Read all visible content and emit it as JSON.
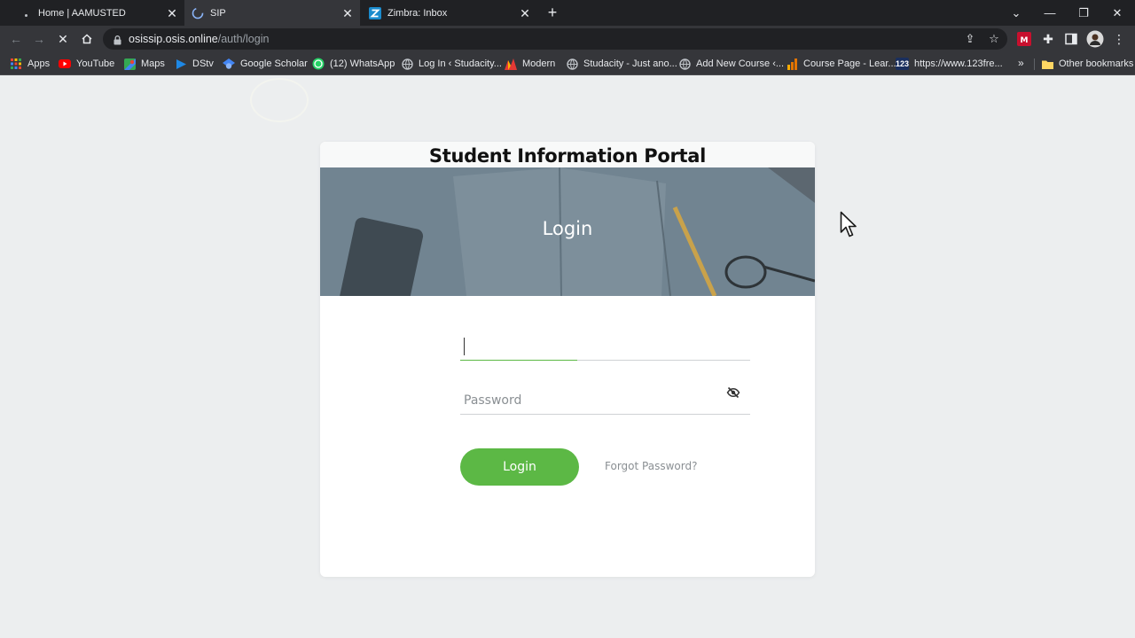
{
  "browser": {
    "tabs": [
      {
        "title": "Home | AAMUSTED",
        "icon": "dot-icon"
      },
      {
        "title": "SIP",
        "icon": "loading-spinner-icon"
      },
      {
        "title": "Zimbra: Inbox",
        "icon": "zimbra-icon"
      }
    ],
    "active_tab": 1,
    "new_tab_label": "+",
    "url": {
      "host": "osissip.osis.online",
      "path": "/auth/login"
    },
    "bookmarks": [
      {
        "label": "Apps",
        "icon": "apps-grid-icon"
      },
      {
        "label": "YouTube",
        "icon": "youtube-icon"
      },
      {
        "label": "Maps",
        "icon": "maps-icon"
      },
      {
        "label": "DStv",
        "icon": "dstv-icon"
      },
      {
        "label": "Google Scholar",
        "icon": "scholar-icon"
      },
      {
        "label": "(12) WhatsApp",
        "icon": "whatsapp-icon"
      },
      {
        "label": "Log In ‹ Studacity...",
        "icon": "globe-icon"
      },
      {
        "label": "Modern",
        "icon": "modern-icon"
      },
      {
        "label": "Studacity - Just ano...",
        "icon": "globe-icon"
      },
      {
        "label": "Add New Course ‹...",
        "icon": "globe-icon"
      },
      {
        "label": "Course Page - Lear...",
        "icon": "analytics-icon"
      },
      {
        "label": "https://www.123fre...",
        "icon": "123-icon"
      }
    ],
    "overflow_label": "»",
    "other_bookmarks": "Other bookmarks"
  },
  "page": {
    "portal_title": "Student Information Portal",
    "banner_title": "Login",
    "username": {
      "value": "",
      "placeholder": ""
    },
    "password": {
      "placeholder": "Password"
    },
    "login_button": "Login",
    "forgot_password": "Forgot Password?"
  },
  "colors": {
    "accent": "#5cb845",
    "page_bg": "#eceeef",
    "banner_overlay": "#6b7d89",
    "chrome_dark": "#202124",
    "chrome_toolbar": "#35363a"
  }
}
